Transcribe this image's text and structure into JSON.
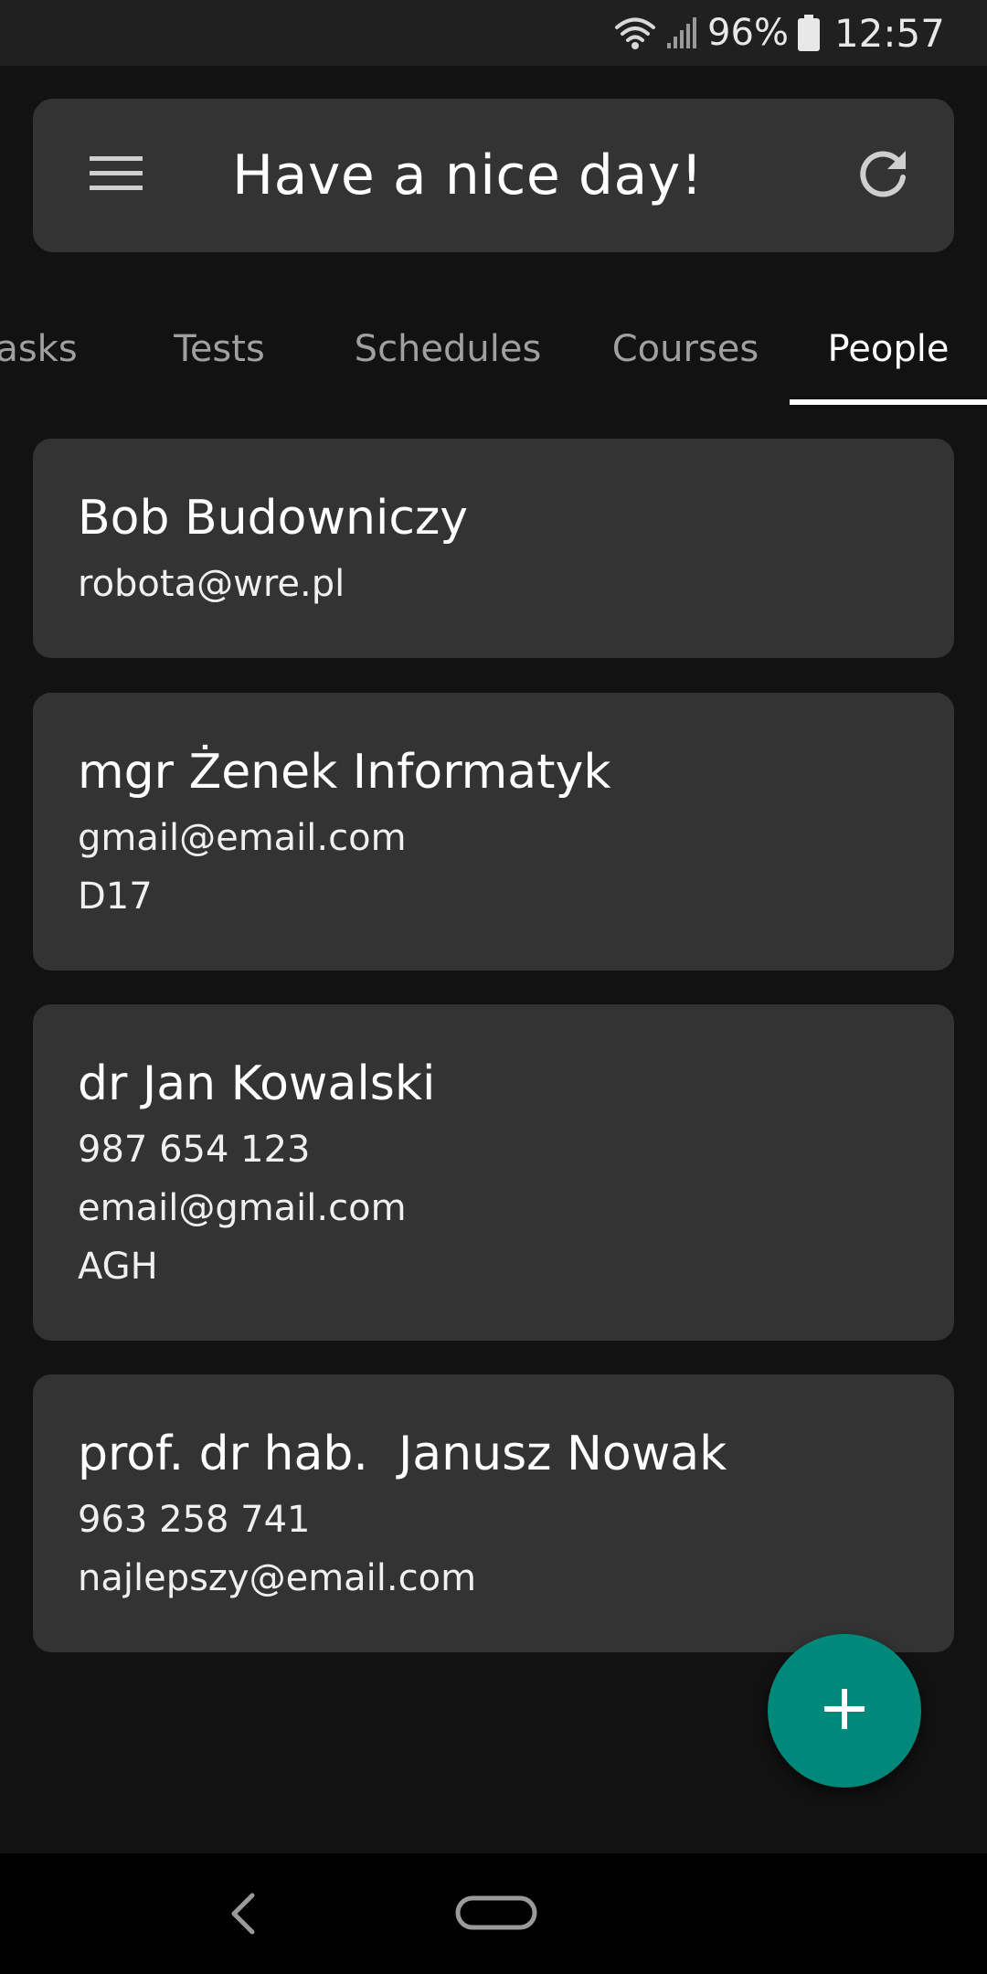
{
  "status_bar": {
    "icons": [
      "wifi-icon",
      "signal-icon",
      "battery-icon"
    ],
    "battery_level": "96%",
    "time": "12:57"
  },
  "app_bar": {
    "menu_icon": "menu-icon",
    "title": "Have a nice day!",
    "refresh_icon": "refresh-icon"
  },
  "tabs": [
    {
      "label": "asks",
      "active": false
    },
    {
      "label": "Tests",
      "active": false
    },
    {
      "label": "Schedules",
      "active": false
    },
    {
      "label": "Courses",
      "active": false
    },
    {
      "label": "People",
      "active": true
    }
  ],
  "people": [
    {
      "name": "Bob Budowniczy",
      "lines": [
        "robota@wre.pl"
      ]
    },
    {
      "name": "mgr Żenek Informatyk",
      "lines": [
        "gmail@email.com",
        "D17"
      ]
    },
    {
      "name": "dr Jan Kowalski",
      "lines": [
        "987 654 123",
        "email@gmail.com",
        "AGH"
      ]
    },
    {
      "name": "prof. dr hab.  Janusz Nowak",
      "lines": [
        "963 258 741",
        "najlepszy@email.com"
      ]
    }
  ],
  "fab": {
    "icon": "plus-icon"
  },
  "nav_bar": {
    "icons": [
      "back-icon",
      "home-icon"
    ]
  },
  "colors": {
    "background": "#121212",
    "surface": "#333333",
    "accent": "#00897b",
    "tab_inactive": "#a0a0a0"
  }
}
